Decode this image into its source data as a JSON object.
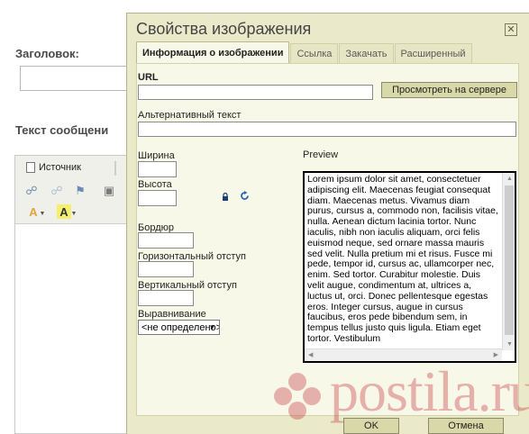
{
  "background": {
    "title_label": "Заголовок:",
    "message_label": "Текст сообщени",
    "toolbar": {
      "source_label": "Источник"
    }
  },
  "dialog": {
    "title": "Свойства изображения",
    "close_icon": "close-x-icon",
    "tabs": [
      {
        "label": "Информация о изображении",
        "active": true
      },
      {
        "label": "Ссылка",
        "active": false
      },
      {
        "label": "Закачать",
        "active": false
      },
      {
        "label": "Расширенный",
        "active": false
      }
    ],
    "fields": {
      "url_label": "URL",
      "url_value": "",
      "browse_server_button": "Просмотреть на сервере",
      "alt_text_label": "Альтернативный текст",
      "alt_text_value": "",
      "width_label": "Ширина",
      "width_value": "",
      "height_label": "Высота",
      "height_value": "",
      "border_label": "Бордюр",
      "border_value": "",
      "hspace_label": "Горизонтальный отступ",
      "hspace_value": "",
      "vspace_label": "Вертикальный отступ",
      "vspace_value": "",
      "align_label": "Выравнивание",
      "align_selected": "<не определено>"
    },
    "preview": {
      "label": "Preview",
      "text": "Lorem ipsum dolor sit amet, consectetuer adipiscing elit. Maecenas feugiat consequat diam. Maecenas metus. Vivamus diam purus, cursus a, commodo non, facilisis vitae, nulla. Aenean dictum lacinia tortor. Nunc iaculis, nibh non iaculis aliquam, orci felis euismod neque, sed ornare massa mauris sed velit. Nulla pretium mi et risus. Fusce mi pede, tempor id, cursus ac, ullamcorper nec, enim. Sed tortor. Curabitur molestie. Duis velit augue, condimentum at, ultrices a, luctus ut, orci. Donec pellentesque egestas eros. Integer cursus, augue in cursus faucibus, eros pede bibendum sem, in tempus tellus justo quis ligula. Etiam eget tortor. Vestibulum"
    },
    "footer": {
      "ok_label": "OK",
      "cancel_label": "Отмена"
    }
  },
  "watermark": {
    "text": "postila.ru"
  },
  "colors": {
    "dialog_bg": "#eaeaca",
    "panel_bg": "#f8f8e8",
    "button_bg": "#d8d8a8",
    "watermark": "#c32837"
  }
}
